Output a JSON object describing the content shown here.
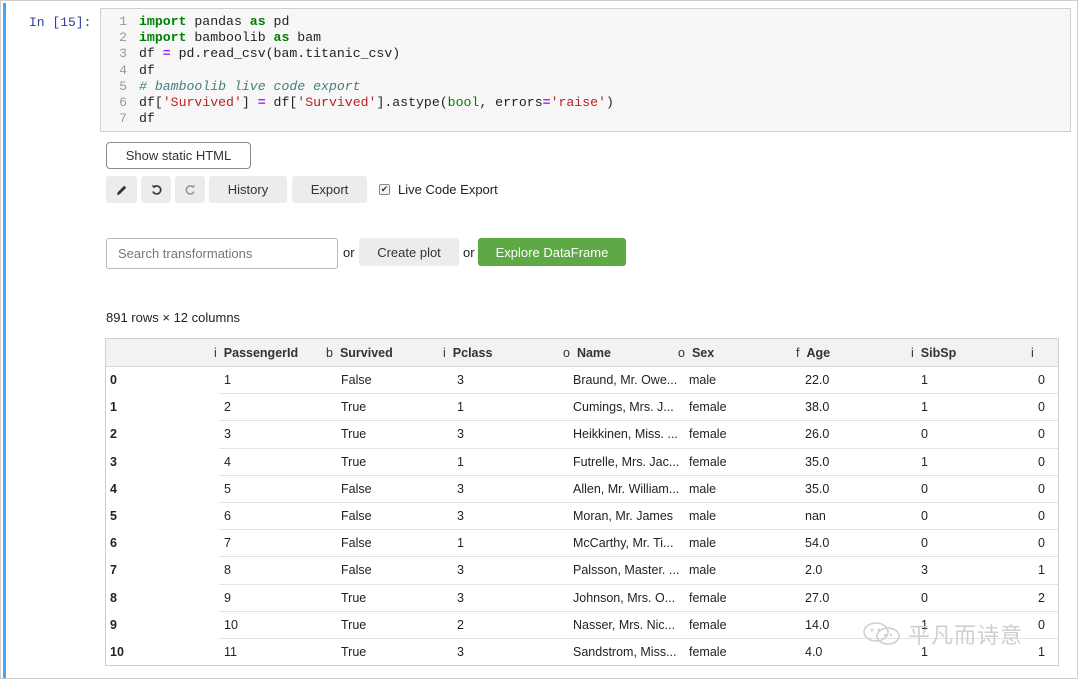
{
  "cell": {
    "prompt": "In [15]:",
    "code_lines": [
      [
        {
          "t": "kw",
          "v": "import"
        },
        {
          "t": "",
          "v": " pandas "
        },
        {
          "t": "kw",
          "v": "as"
        },
        {
          "t": "",
          "v": " pd"
        }
      ],
      [
        {
          "t": "kw",
          "v": "import"
        },
        {
          "t": "",
          "v": " bamboolib "
        },
        {
          "t": "kw",
          "v": "as"
        },
        {
          "t": "",
          "v": " bam"
        }
      ],
      [
        {
          "t": "",
          "v": "df "
        },
        {
          "t": "op",
          "v": "="
        },
        {
          "t": "",
          "v": " pd.read_csv(bam.titanic_csv)"
        }
      ],
      [
        {
          "t": "",
          "v": "df"
        }
      ],
      [
        {
          "t": "cm",
          "v": "# bamboolib live code export"
        }
      ],
      [
        {
          "t": "",
          "v": "df["
        },
        {
          "t": "str",
          "v": "'Survived'"
        },
        {
          "t": "",
          "v": "] "
        },
        {
          "t": "op",
          "v": "="
        },
        {
          "t": "",
          "v": " df["
        },
        {
          "t": "str",
          "v": "'Survived'"
        },
        {
          "t": "",
          "v": "].astype("
        },
        {
          "t": "bi",
          "v": "bool"
        },
        {
          "t": "",
          "v": ", errors"
        },
        {
          "t": "op",
          "v": "="
        },
        {
          "t": "str",
          "v": "'raise'"
        },
        {
          "t": "",
          "v": ")"
        }
      ],
      [
        {
          "t": "",
          "v": "df"
        }
      ]
    ]
  },
  "toolbar": {
    "show_static_html": "Show static HTML",
    "history": "History",
    "export": "Export",
    "live_code_export": "Live Code Export",
    "live_code_export_checked": true,
    "icons": [
      "pencil-icon",
      "undo-icon",
      "redo-icon"
    ]
  },
  "actions": {
    "search_placeholder": "Search transformations",
    "or1": "or",
    "create_plot": "Create plot",
    "or2": "or",
    "explore": "Explore DataFrame",
    "explore_color": "#5ea845"
  },
  "table": {
    "summary": "891 rows × 12 columns",
    "columns": [
      {
        "type": "i",
        "name": "PassengerId"
      },
      {
        "type": "b",
        "name": "Survived"
      },
      {
        "type": "i",
        "name": "Pclass"
      },
      {
        "type": "o",
        "name": "Name"
      },
      {
        "type": "o",
        "name": "Sex"
      },
      {
        "type": "f",
        "name": "Age"
      },
      {
        "type": "i",
        "name": "SibSp"
      },
      {
        "type": "i",
        "name": ""
      }
    ],
    "rows": [
      [
        "0",
        "1",
        "False",
        "3",
        "Braund, Mr. Owe...",
        "male",
        "22.0",
        "1",
        "0"
      ],
      [
        "1",
        "2",
        "True",
        "1",
        "Cumings, Mrs. J...",
        "female",
        "38.0",
        "1",
        "0"
      ],
      [
        "2",
        "3",
        "True",
        "3",
        "Heikkinen, Miss. ...",
        "female",
        "26.0",
        "0",
        "0"
      ],
      [
        "3",
        "4",
        "True",
        "1",
        "Futrelle, Mrs. Jac...",
        "female",
        "35.0",
        "1",
        "0"
      ],
      [
        "4",
        "5",
        "False",
        "3",
        "Allen, Mr. William...",
        "male",
        "35.0",
        "0",
        "0"
      ],
      [
        "5",
        "6",
        "False",
        "3",
        "Moran, Mr. James",
        "male",
        "nan",
        "0",
        "0"
      ],
      [
        "6",
        "7",
        "False",
        "1",
        "McCarthy, Mr. Ti...",
        "male",
        "54.0",
        "0",
        "0"
      ],
      [
        "7",
        "8",
        "False",
        "3",
        "Palsson, Master. ...",
        "male",
        "2.0",
        "3",
        "1"
      ],
      [
        "8",
        "9",
        "True",
        "3",
        "Johnson, Mrs. O...",
        "female",
        "27.0",
        "0",
        "2"
      ],
      [
        "9",
        "10",
        "True",
        "2",
        "Nasser, Mrs. Nic...",
        "female",
        "14.0",
        "1",
        "0"
      ],
      [
        "10",
        "11",
        "True",
        "3",
        "Sandstrom, Miss...",
        "female",
        "4.0",
        "1",
        "1"
      ]
    ]
  },
  "watermark": "平凡而诗意"
}
